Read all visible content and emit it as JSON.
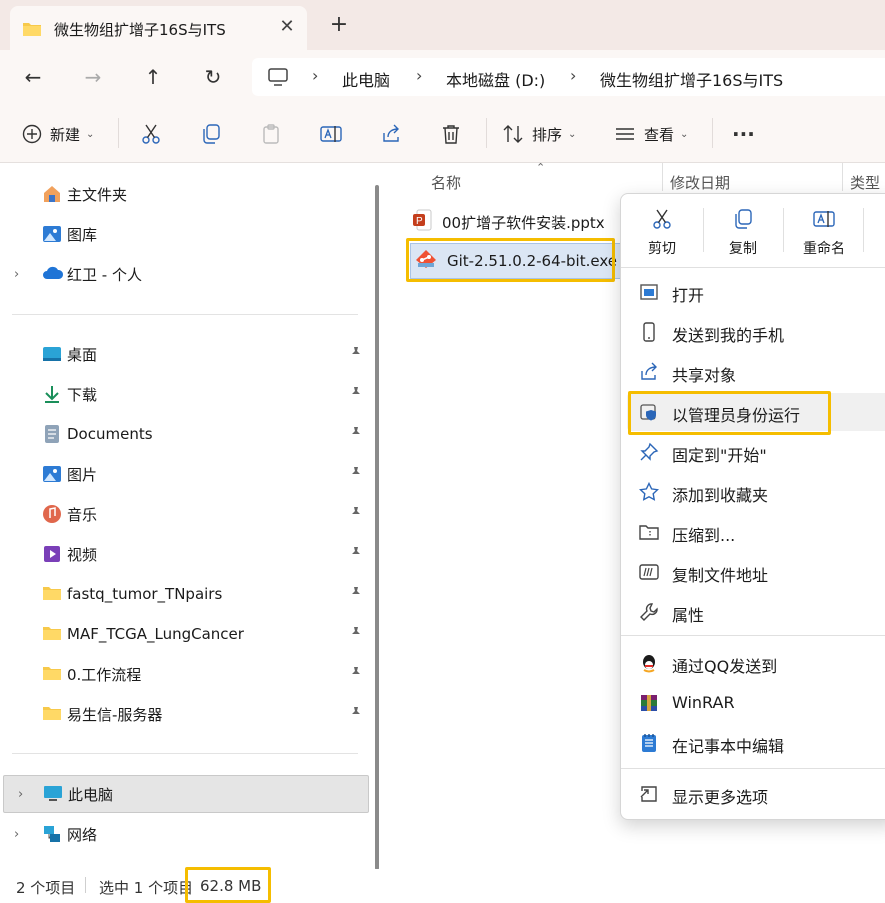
{
  "tab": {
    "title": "微生物组扩增子16S与ITS",
    "close": "✕",
    "new": "+"
  },
  "address": {
    "crumbs": [
      "此电脑",
      "本地磁盘 (D:)",
      "微生物组扩增子16S与ITS"
    ],
    "separator": "›"
  },
  "nav_buttons": {
    "back": "←",
    "forward": "→",
    "up": "↑",
    "refresh": "↻"
  },
  "toolbar": {
    "new_label": "新建",
    "sort_label": "排序",
    "view_label": "查看",
    "more_label": "···",
    "caret": "⌄"
  },
  "sidebar": {
    "top": [
      {
        "label": "主文件夹",
        "icon": "home-icon"
      },
      {
        "label": "图库",
        "icon": "gallery-icon"
      },
      {
        "label": "红卫 - 个人",
        "icon": "onedrive-cloud-icon"
      }
    ],
    "pinned": [
      {
        "label": "桌面",
        "icon": "desktop-icon"
      },
      {
        "label": "下载",
        "icon": "download-icon"
      },
      {
        "label": "Documents",
        "icon": "documents-icon"
      },
      {
        "label": "图片",
        "icon": "pictures-icon"
      },
      {
        "label": "音乐",
        "icon": "music-icon"
      },
      {
        "label": "视频",
        "icon": "video-icon"
      },
      {
        "label": "fastq_tumor_TNpairs",
        "icon": "folder-icon"
      },
      {
        "label": "MAF_TCGA_LungCancer",
        "icon": "folder-icon"
      },
      {
        "label": "0.工作流程",
        "icon": "folder-icon"
      },
      {
        "label": "易生信-服务器",
        "icon": "folder-icon"
      }
    ],
    "bottom": [
      {
        "label": "此电脑",
        "icon": "this-pc-icon",
        "selected": true
      },
      {
        "label": "网络",
        "icon": "network-icon"
      }
    ],
    "chevron": "›"
  },
  "filelist": {
    "columns": [
      "名称",
      "修改日期",
      "类型"
    ],
    "sort_indicator": "⌃",
    "files": [
      {
        "name": "00扩增子软件安装.pptx",
        "icon": "powerpoint-file-icon"
      },
      {
        "name": "Git-2.51.0.2-64-bit.exe",
        "icon": "git-installer-icon",
        "selected": true
      }
    ]
  },
  "status": {
    "count": "2 个项目",
    "selected": "选中 1 个项目",
    "size": "62.8 MB"
  },
  "context_menu": {
    "actions": [
      {
        "label": "剪切",
        "icon": "cut-icon"
      },
      {
        "label": "复制",
        "icon": "copy-icon"
      },
      {
        "label": "重命名",
        "icon": "rename-icon"
      }
    ],
    "group1": [
      {
        "label": "打开",
        "icon": "open-icon"
      },
      {
        "label": "发送到我的手机",
        "icon": "phone-icon"
      },
      {
        "label": "共享对象",
        "icon": "share-icon"
      },
      {
        "label": "以管理员身份运行",
        "icon": "shield-icon",
        "highlighted": true
      },
      {
        "label": "固定到\"开始\"",
        "icon": "pin-icon"
      },
      {
        "label": "添加到收藏夹",
        "icon": "star-icon"
      },
      {
        "label": "压缩到...",
        "icon": "zip-icon"
      },
      {
        "label": "复制文件地址",
        "icon": "copy-path-icon"
      },
      {
        "label": "属性",
        "icon": "wrench-icon"
      }
    ],
    "group2": [
      {
        "label": "通过QQ发送到",
        "icon": "qq-icon"
      },
      {
        "label": "WinRAR",
        "icon": "winrar-icon"
      },
      {
        "label": "在记事本中编辑",
        "icon": "notepad-icon"
      }
    ],
    "group3": [
      {
        "label": "显示更多选项",
        "icon": "more-options-icon"
      }
    ]
  },
  "colors": {
    "highlight": "#f5bd00",
    "title_bg": "#f3e9e6",
    "selection": "#dbe6f4"
  }
}
